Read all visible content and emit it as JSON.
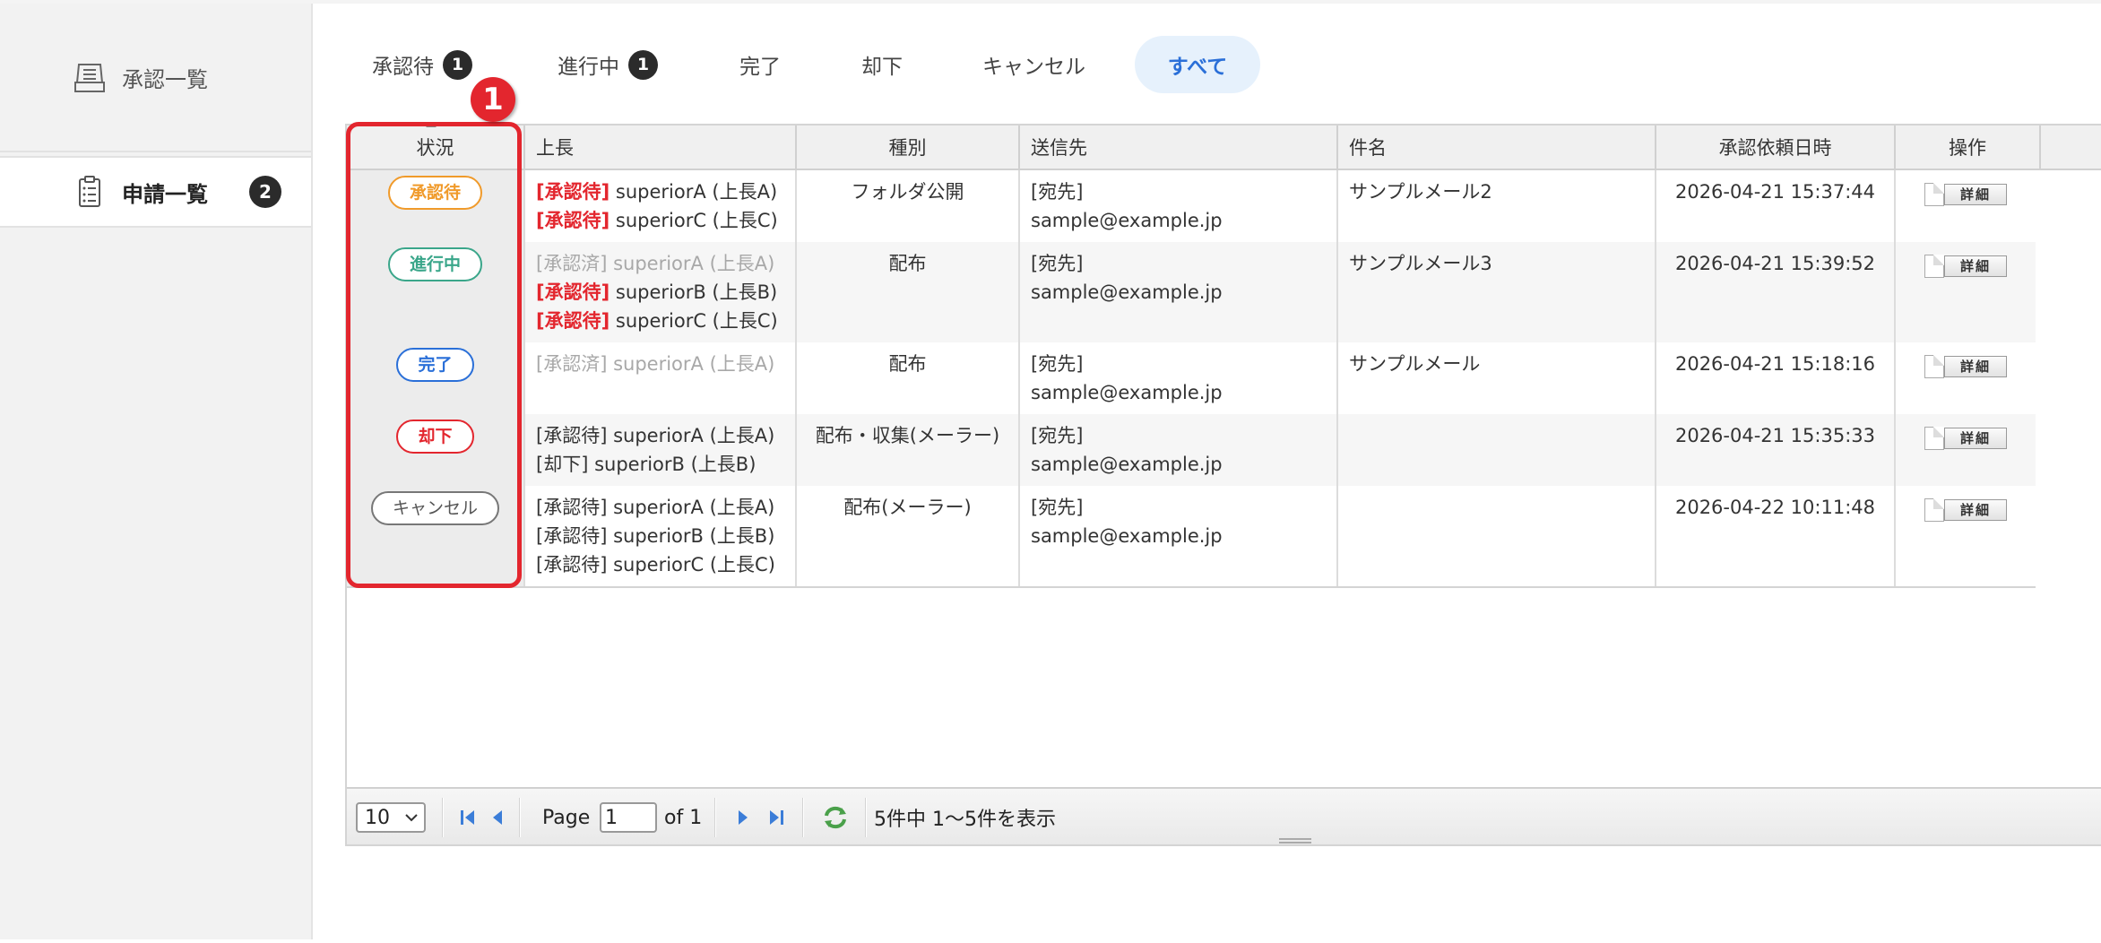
{
  "sidebar": {
    "items": [
      {
        "label": "承認一覧",
        "icon": "inbox-tray-icon"
      },
      {
        "label": "申請一覧",
        "icon": "clipboard-list-icon",
        "badge": "2"
      }
    ]
  },
  "tabs": [
    {
      "label": "承認待",
      "badge": "1"
    },
    {
      "label": "進行中",
      "badge": "1"
    },
    {
      "label": "完了"
    },
    {
      "label": "却下"
    },
    {
      "label": "キャンセル"
    },
    {
      "label": "すべて",
      "selected": true
    }
  ],
  "table": {
    "headers": [
      "状況",
      "上長",
      "種別",
      "送信先",
      "件名",
      "承認依頼日時",
      "操作"
    ],
    "detail_label": "詳細",
    "rows": [
      {
        "status": "承認待",
        "superiors": [
          {
            "tag": "[承認待]",
            "name": "superiorA (上長A)"
          },
          {
            "tag": "[承認待]",
            "name": "superiorC (上長C)"
          }
        ],
        "type": "フォルダ公開",
        "dest_label": "[宛先]",
        "dest_email": "sample@example.jp",
        "subject": "サンプルメール2",
        "date": "2026-04-21 15:37:44"
      },
      {
        "status": "進行中",
        "superiors": [
          {
            "tag": "[承認済]",
            "name": "superiorA (上長A)"
          },
          {
            "tag": "[承認待]",
            "name": "superiorB (上長B)"
          },
          {
            "tag": "[承認待]",
            "name": "superiorC (上長C)"
          }
        ],
        "type": "配布",
        "dest_label": "[宛先]",
        "dest_email": "sample@example.jp",
        "subject": "サンプルメール3",
        "date": "2026-04-21 15:39:52"
      },
      {
        "status": "完了",
        "superiors": [
          {
            "tag": "[承認済]",
            "name": "superiorA (上長A)"
          }
        ],
        "type": "配布",
        "dest_label": "[宛先]",
        "dest_email": "sample@example.jp",
        "subject": "サンプルメール",
        "date": "2026-04-21 15:18:16"
      },
      {
        "status": "却下",
        "superiors": [
          {
            "tag": "[承認待]",
            "name": "superiorA (上長A)"
          },
          {
            "tag": "[却下]",
            "name": "superiorB (上長B)"
          }
        ],
        "type": "配布・収集(メーラー)",
        "dest_label": "[宛先]",
        "dest_email": "sample@example.jp",
        "subject": "",
        "date": "2026-04-21 15:35:33"
      },
      {
        "status": "キャンセル",
        "superiors": [
          {
            "tag": "[承認待]",
            "name": "superiorA (上長A)"
          },
          {
            "tag": "[承認待]",
            "name": "superiorB (上長B)"
          },
          {
            "tag": "[承認待]",
            "name": "superiorC (上長C)"
          }
        ],
        "type": "配布(メーラー)",
        "dest_label": "[宛先]",
        "dest_email": "sample@example.jp",
        "subject": "",
        "date": "2026-04-22 10:11:48"
      }
    ]
  },
  "pager": {
    "page_size": "10",
    "page_label": "Page",
    "page_value": "1",
    "of_label": "of 1",
    "summary": "5件中 1〜5件を表示"
  },
  "annotation": {
    "number": "1"
  },
  "colors": {
    "accent_red": "#e3262e",
    "selected_tab_bg": "#e6f1fc",
    "selected_tab_text": "#2a6fd8",
    "status_orange": "#f09a2a",
    "status_green": "#3aa68a",
    "status_blue": "#2a6fd8",
    "status_red": "#e3262e",
    "status_gray": "#777777"
  }
}
